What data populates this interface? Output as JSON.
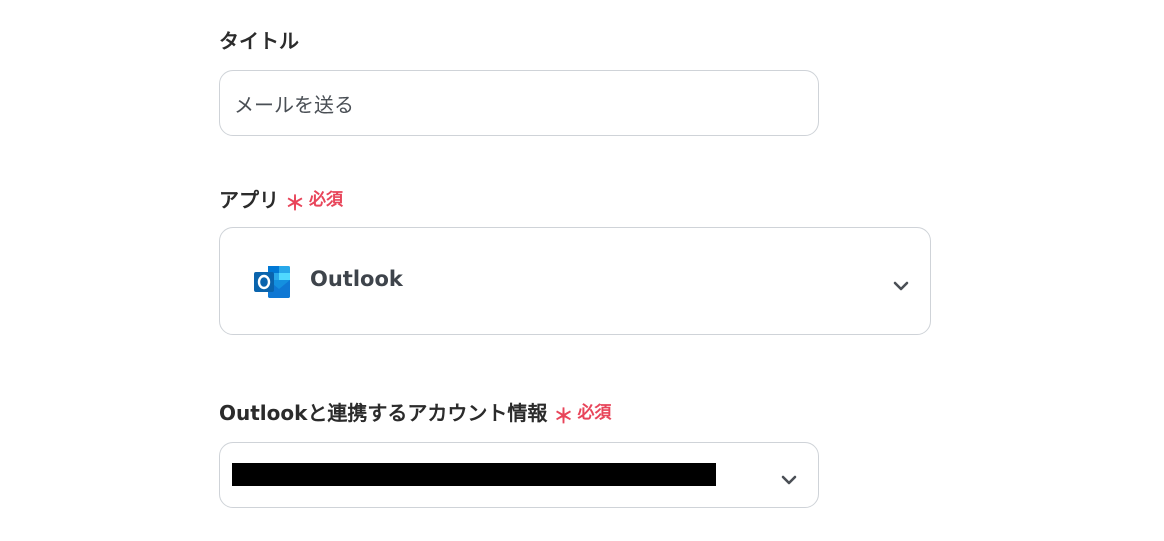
{
  "title_field": {
    "label": "タイトル",
    "value": "メールを送る"
  },
  "app_field": {
    "label": "アプリ",
    "required_mark": "＊",
    "required_text": "必須",
    "selected_app": "Outlook",
    "app_icon": "outlook-logo-icon",
    "dropdown_icon": "chevron-down-icon"
  },
  "account_field": {
    "label": "Outlookと連携するアカウント情報",
    "required_mark": "＊",
    "required_text": "必須",
    "value_redacted": true,
    "dropdown_icon": "chevron-down-icon"
  },
  "colors": {
    "required": "#e8455a",
    "border": "#cfd3d8",
    "text": "#2b2b2b",
    "outlook_blue": "#0f78d4"
  }
}
